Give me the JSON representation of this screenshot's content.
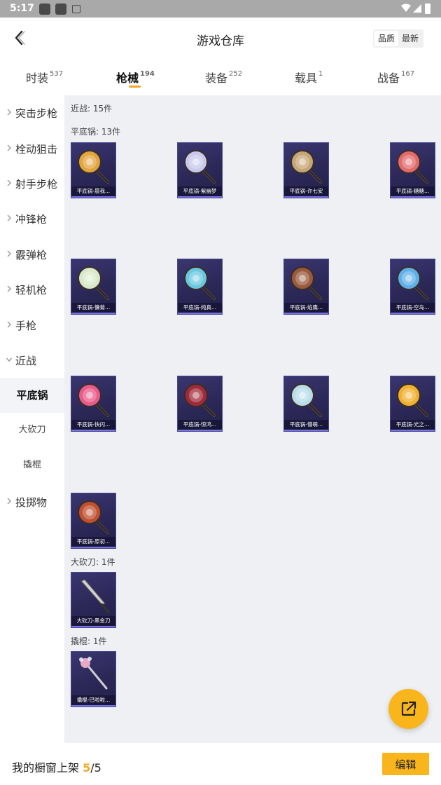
{
  "status_bar": {
    "time": "5:17"
  },
  "header": {
    "title": "游戏仓库",
    "sort_options": [
      "品质",
      "最新"
    ],
    "sort_selected": "品质"
  },
  "tabs": [
    {
      "label": "时装",
      "count": "537"
    },
    {
      "label": "枪械",
      "count": "194",
      "active": true
    },
    {
      "label": "装备",
      "count": "252"
    },
    {
      "label": "载具",
      "count": "1"
    },
    {
      "label": "战备",
      "count": "167"
    }
  ],
  "sidebar": {
    "categories": [
      "突击步枪",
      "栓动狙击",
      "射手步枪",
      "冲锋枪",
      "霰弹枪",
      "轻机枪",
      "手枪",
      "近战",
      "投掷物"
    ],
    "subcategories": [
      "平底锅",
      "大砍刀",
      "撬棍"
    ],
    "active_sub": "平底锅"
  },
  "content": {
    "melee_header": "近战: 15件",
    "pan_header": "平底锅: 13件",
    "machete_header": "大砍刀: 1件",
    "crowbar_header": "撬棍: 1件",
    "pan_items": [
      {
        "name": "平底锅-晨我...",
        "icon": "pan-icon",
        "color": "#e2a43c"
      },
      {
        "name": "平底锅-紫幽梦",
        "icon": "pan-icon",
        "color": "#c9c9ec"
      },
      {
        "name": "平底锅-许七安",
        "icon": "pan-icon",
        "color": "#c7a676"
      },
      {
        "name": "平底锅-糖糖...",
        "icon": "pan-icon",
        "color": "#e36a6a"
      },
      {
        "name": "平底锅-慵菊...",
        "icon": "pan-icon",
        "color": "#d8e8c8"
      },
      {
        "name": "平底锅-纯真...",
        "icon": "pan-icon",
        "color": "#6bc7e0"
      },
      {
        "name": "平底锅-焰鹰...",
        "icon": "pan-icon",
        "color": "#9a5a3c"
      },
      {
        "name": "平底锅-空岛...",
        "icon": "pan-icon",
        "color": "#5fb0e8"
      },
      {
        "name": "平底锅-快闪...",
        "icon": "pan-icon",
        "color": "#e85a8a"
      },
      {
        "name": "平底锅-惊鸿...",
        "icon": "pan-icon",
        "color": "#a02a3a"
      },
      {
        "name": "平底锅-懵萌...",
        "icon": "pan-icon",
        "color": "#b8dde8"
      },
      {
        "name": "平底锅-光之...",
        "icon": "pan-icon",
        "color": "#f0b030"
      },
      {
        "name": "平底锅-原初...",
        "icon": "pan-icon",
        "color": "#c05030"
      }
    ],
    "machete_items": [
      {
        "name": "大砍刀-黑金刀",
        "icon": "machete-icon",
        "color": "#cfcfcf"
      }
    ],
    "crowbar_items": [
      {
        "name": "撬棍-巴啦啦...",
        "icon": "crowbar-icon",
        "color": "#e8a8c8"
      }
    ]
  },
  "bottom_bar": {
    "showcase_label": "我的橱窗上架",
    "showcase_current": "5",
    "showcase_sep": "/",
    "showcase_max": "5",
    "edit_label": "编辑"
  }
}
